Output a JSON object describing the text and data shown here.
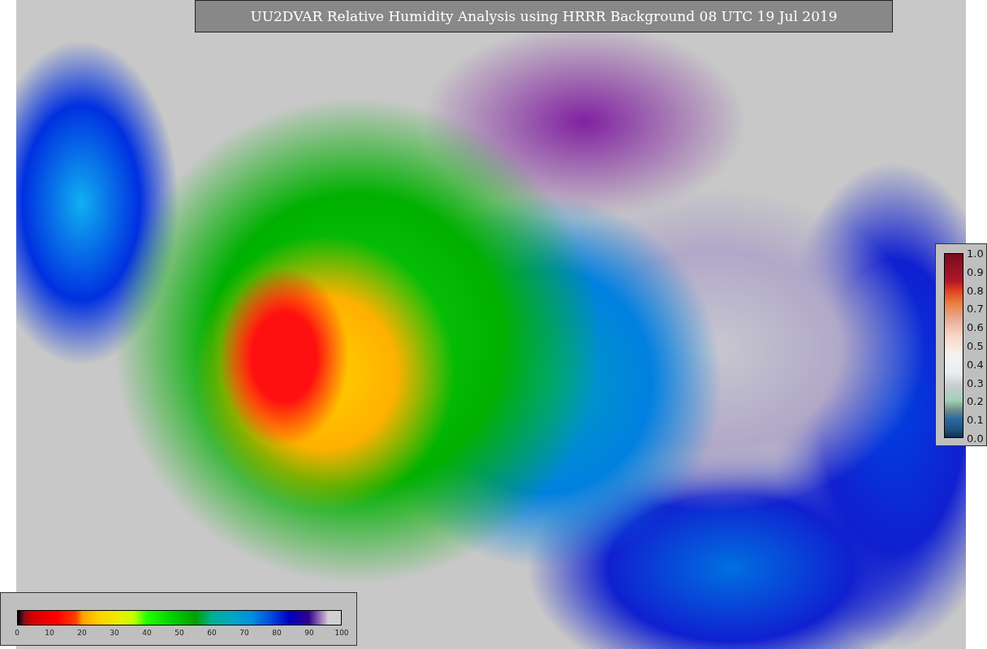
{
  "title": "UU2DVAR Relative Humidity Analysis using HRRR Background 08 UTC 19 Jul 2019",
  "humidity_colorbar": {
    "ticks": [
      "0",
      "10",
      "20",
      "30",
      "40",
      "50",
      "60",
      "70",
      "80",
      "90",
      "100"
    ]
  },
  "probability_colorbar": {
    "ticks": [
      "1.0",
      "0.9",
      "0.8",
      "0.7",
      "0.6",
      "0.5",
      "0.4",
      "0.3",
      "0.2",
      "0.1",
      "0.0"
    ]
  }
}
